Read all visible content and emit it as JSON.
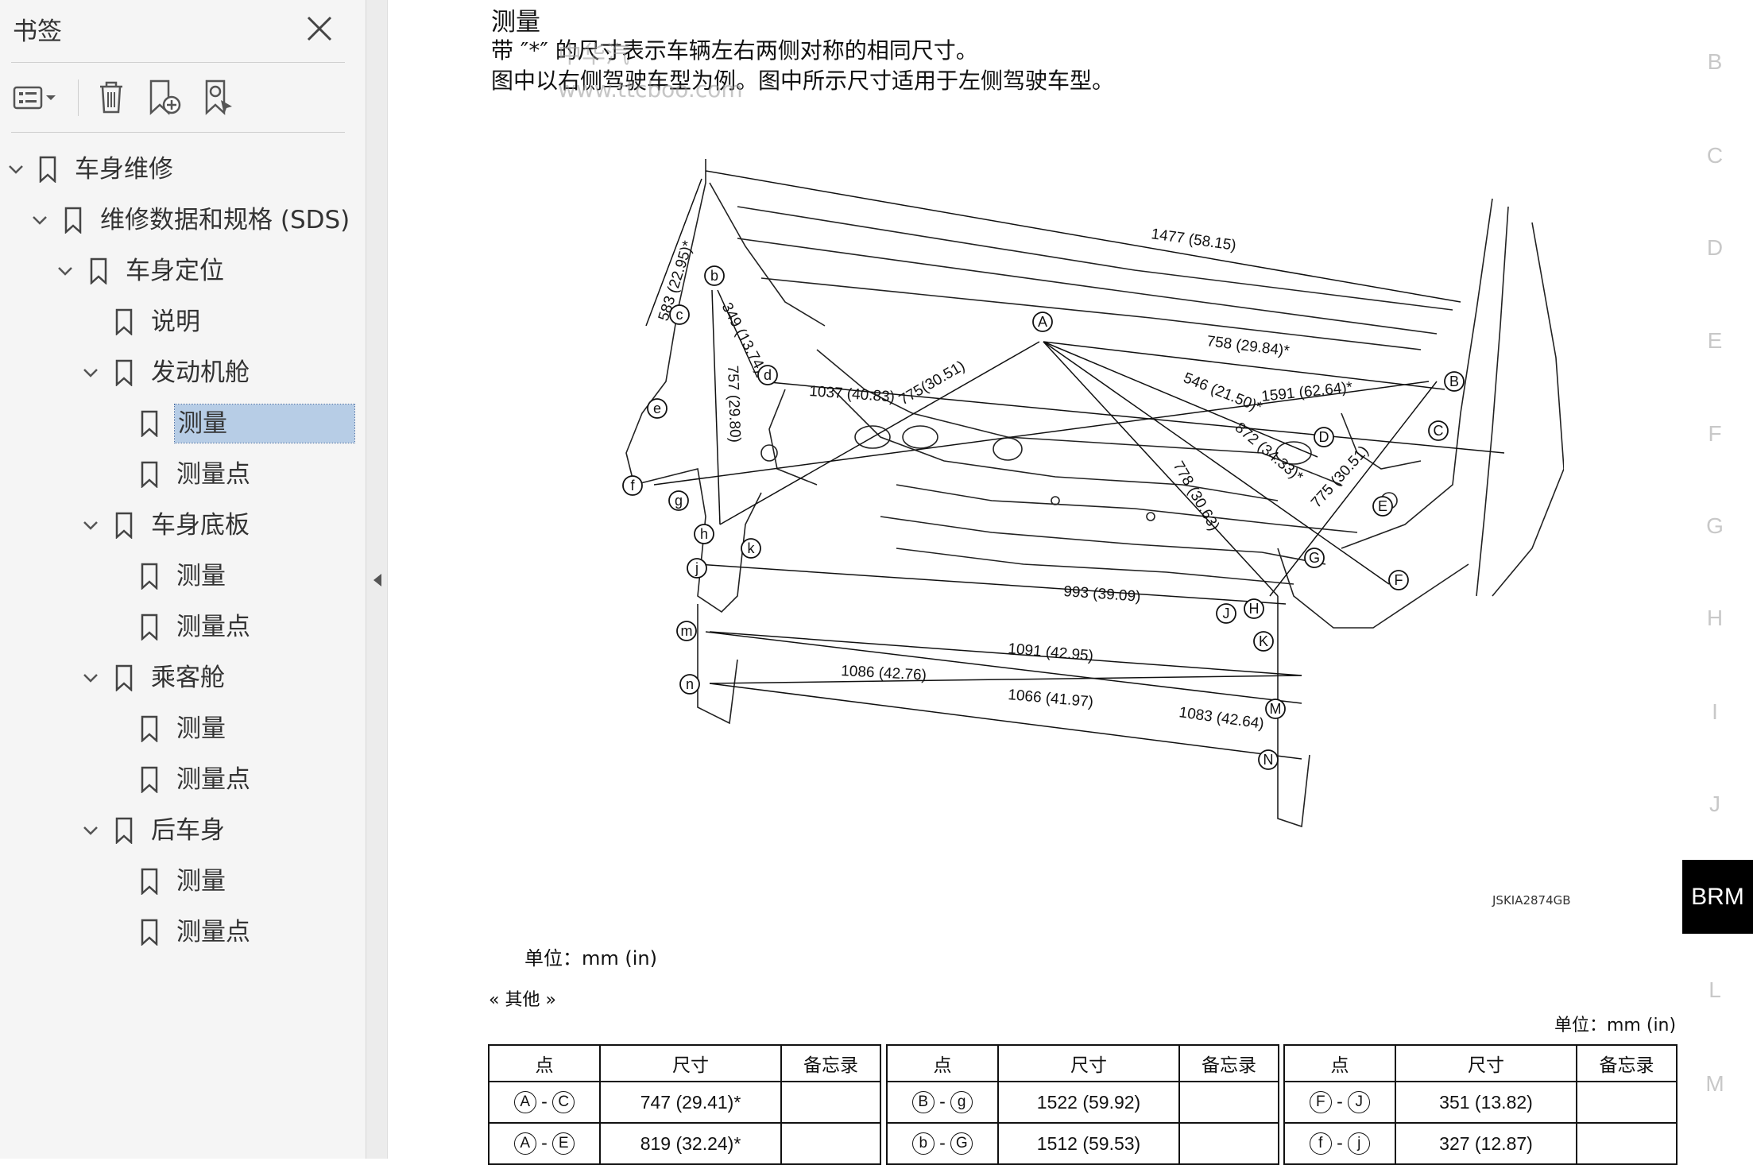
{
  "sidebar": {
    "title": "书签",
    "tree": [
      {
        "label": "车身维修",
        "level": 0,
        "expanded": true
      },
      {
        "label": "维修数据和规格 (SDS)",
        "level": 1,
        "expanded": true
      },
      {
        "label": "车身定位",
        "level": 2,
        "expanded": true
      },
      {
        "label": "说明",
        "level": 3
      },
      {
        "label": "发动机舱",
        "level": 3,
        "expanded": true
      },
      {
        "label": "测量",
        "level": 4,
        "selected": true
      },
      {
        "label": "测量点",
        "level": 4
      },
      {
        "label": "车身底板",
        "level": 3,
        "expanded": true
      },
      {
        "label": "测量",
        "level": 4
      },
      {
        "label": "测量点",
        "level": 4
      },
      {
        "label": "乘客舱",
        "level": 3,
        "expanded": true
      },
      {
        "label": "测量",
        "level": 4
      },
      {
        "label": "测量点",
        "level": 4
      },
      {
        "label": "后车身",
        "level": 3,
        "expanded": true
      },
      {
        "label": "测量",
        "level": 4
      },
      {
        "label": "测量点",
        "level": 4
      }
    ]
  },
  "document": {
    "heading": "测量",
    "note1": "带 ″*″ 的尺寸表示车辆左右两侧对称的相同尺寸。",
    "note2": "图中以右侧驾驶车型为例。图中所示尺寸适用于左侧驾驶车型。",
    "watermark1": "中华汽",
    "watermark2": "www.ttcboo.com",
    "diagram_code": "JSKIA2874GB",
    "unit_label": "单位：mm (in)",
    "other_link": "« 其他 »",
    "unit_label2": "单位：mm (in)",
    "diagram_labels": {
      "d1477": "1477 (58.15)",
      "d583": "583 (22.95)*",
      "d349": "349 (13.74)*",
      "d757": "757 (29.80)",
      "d1037": "1037 (40.83)",
      "d775a": "775(30.51)",
      "d758": "758 (29.84)*",
      "d546": "546 (21.50)*",
      "d1591": "1591 (62.64)*",
      "d872": "872 (34.33)*",
      "d778": "778 (30.63)",
      "d775b": "775 (30.51)",
      "d993": "993 (39.09)",
      "d1091": "1091 (42.95)",
      "d1086": "1086 (42.76)",
      "d1066": "1066 (41.97)",
      "d1083": "1083 (42.64)"
    },
    "diagram_points": {
      "A": "A",
      "B": "B",
      "C": "C",
      "D": "D",
      "E": "E",
      "F": "F",
      "G": "G",
      "H": "H",
      "J": "J",
      "K": "K",
      "M": "M",
      "N": "N",
      "b": "b",
      "c": "c",
      "d": "d",
      "e": "e",
      "f": "f",
      "g": "g",
      "h": "h",
      "j": "j",
      "k": "k",
      "m": "m",
      "n": "n"
    },
    "table": {
      "headers": {
        "point": "点",
        "size": "尺寸",
        "memo": "备忘录"
      },
      "rows": [
        [
          {
            "p1": "A",
            "p2": "C",
            "size": "747 (29.41)*",
            "memo": ""
          },
          {
            "p1": "B",
            "p2": "g",
            "size": "1522 (59.92)",
            "memo": ""
          },
          {
            "p1": "F",
            "p2": "J",
            "size": "351 (13.82)",
            "memo": ""
          }
        ],
        [
          {
            "p1": "A",
            "p2": "E",
            "size": "819 (32.24)*",
            "memo": ""
          },
          {
            "p1": "b",
            "p2": "G",
            "size": "1512 (59.53)",
            "memo": ""
          },
          {
            "p1": "f",
            "p2": "j",
            "size": "327 (12.87)",
            "memo": ""
          }
        ]
      ]
    }
  },
  "index_tabs": [
    "B",
    "C",
    "D",
    "E",
    "F",
    "G",
    "H",
    "I",
    "J",
    "BRM",
    "L",
    "M"
  ],
  "active_index": "BRM",
  "colors": {
    "selected_bg": "#b7cde6",
    "active_tab_bg": "#000000",
    "tab_text": "#c8c8c8"
  }
}
